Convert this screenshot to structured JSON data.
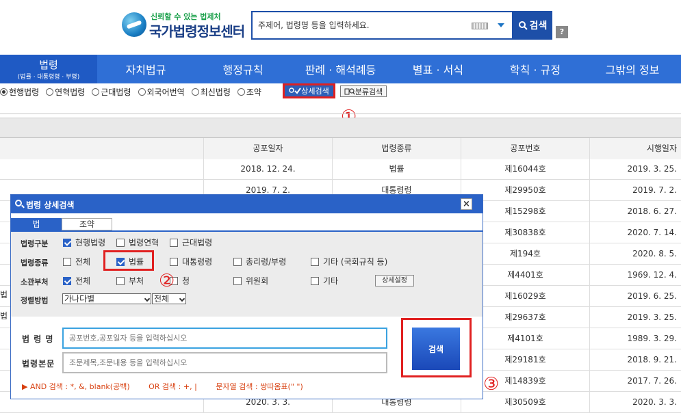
{
  "header": {
    "logo_slogan": "신뢰할 수 있는 법제처",
    "logo_name": "국가법령정보센터",
    "search_placeholder": "주제어, 법령명 등을 입력하세요.",
    "search_button": "검색",
    "help": "?"
  },
  "nav": [
    {
      "label": "법령",
      "sub": "(법률 · 대통령령 · 부령)"
    },
    {
      "label": "자치법규"
    },
    {
      "label": "행정규칙"
    },
    {
      "label": "판례 · 해석례등"
    },
    {
      "label": "별표 · 서식"
    },
    {
      "label": "학칙 · 규정"
    },
    {
      "label": "그밖의 정보"
    }
  ],
  "radios": [
    "현행법령",
    "연혁법령",
    "근대법령",
    "외국어번역",
    "최신법령",
    "조약"
  ],
  "detail_search_button": "상세검색",
  "class_search_button": "분류검색",
  "annotations": {
    "one": "①",
    "two": "②",
    "three": "③"
  },
  "table": {
    "headers": [
      "공포일자",
      "법령종류",
      "공포번호",
      "시행일자"
    ],
    "rows": [
      [
        "2018. 12. 24.",
        "법률",
        "제16044호",
        "2019. 3. 25."
      ],
      [
        "2019. 7. 2.",
        "대통령령",
        "제29950호",
        "2019. 7. 2."
      ],
      [
        "",
        "",
        "제15298호",
        "2018. 6. 27."
      ],
      [
        "",
        "",
        "제30838호",
        "2020. 7. 14."
      ],
      [
        "",
        "",
        "제194호",
        "2020. 8. 5."
      ],
      [
        "",
        "",
        "제4401호",
        "1969. 12. 4."
      ],
      [
        "",
        "",
        "제16029호",
        "2019. 6. 25."
      ],
      [
        "",
        "",
        "제29637호",
        "2019. 3. 25."
      ],
      [
        "",
        "",
        "제4101호",
        "1989. 3. 29."
      ],
      [
        "",
        "",
        "제29181호",
        "2018. 9. 21."
      ],
      [
        "",
        "",
        "제14839호",
        "2017. 7. 26."
      ],
      [
        "2020. 3. 3.",
        "대통령령",
        "제30509호",
        "2020. 3. 3."
      ]
    ],
    "side_fragment": "법"
  },
  "modal": {
    "title": "법령 상세검색",
    "close": "×",
    "tabs": [
      "법",
      "조약"
    ],
    "rows": {
      "gubun": {
        "label": "법령구분",
        "options": [
          {
            "t": "현행법령",
            "on": true
          },
          {
            "t": "법령연혁",
            "on": false
          },
          {
            "t": "근대법령",
            "on": false
          }
        ]
      },
      "kind": {
        "label": "법령종류",
        "options": [
          {
            "t": "전체",
            "on": false
          },
          {
            "t": "법률",
            "on": true
          },
          {
            "t": "대통령령",
            "on": false
          },
          {
            "t": "총리령/부령",
            "on": false
          },
          {
            "t": "기타 (국회규칙 등)",
            "on": false
          }
        ]
      },
      "dept": {
        "label": "소관부처",
        "options": [
          {
            "t": "전체",
            "on": true
          },
          {
            "t": "부처",
            "on": false
          },
          {
            "t": "청",
            "on": false
          },
          {
            "t": "위원회",
            "on": false
          },
          {
            "t": "기타",
            "on": false
          }
        ]
      },
      "sort": {
        "label": "정렬방법",
        "select1": "가나다별",
        "select2": "전체"
      }
    },
    "detail_setting": "상세설정",
    "law_name_label": "법 령 명",
    "law_name_placeholder": "공포번호,공포일자 등을 입력하십시오",
    "law_body_label": "법령본문",
    "law_body_placeholder": "조문제목,조문내용 등을 입력하십시오",
    "search_button": "검색",
    "hints": [
      "▶ AND 검색 : *, &, blank(공백)",
      "OR 검색 : +, |",
      "문자열 검색 : 쌍따옴표(\" \")"
    ]
  }
}
